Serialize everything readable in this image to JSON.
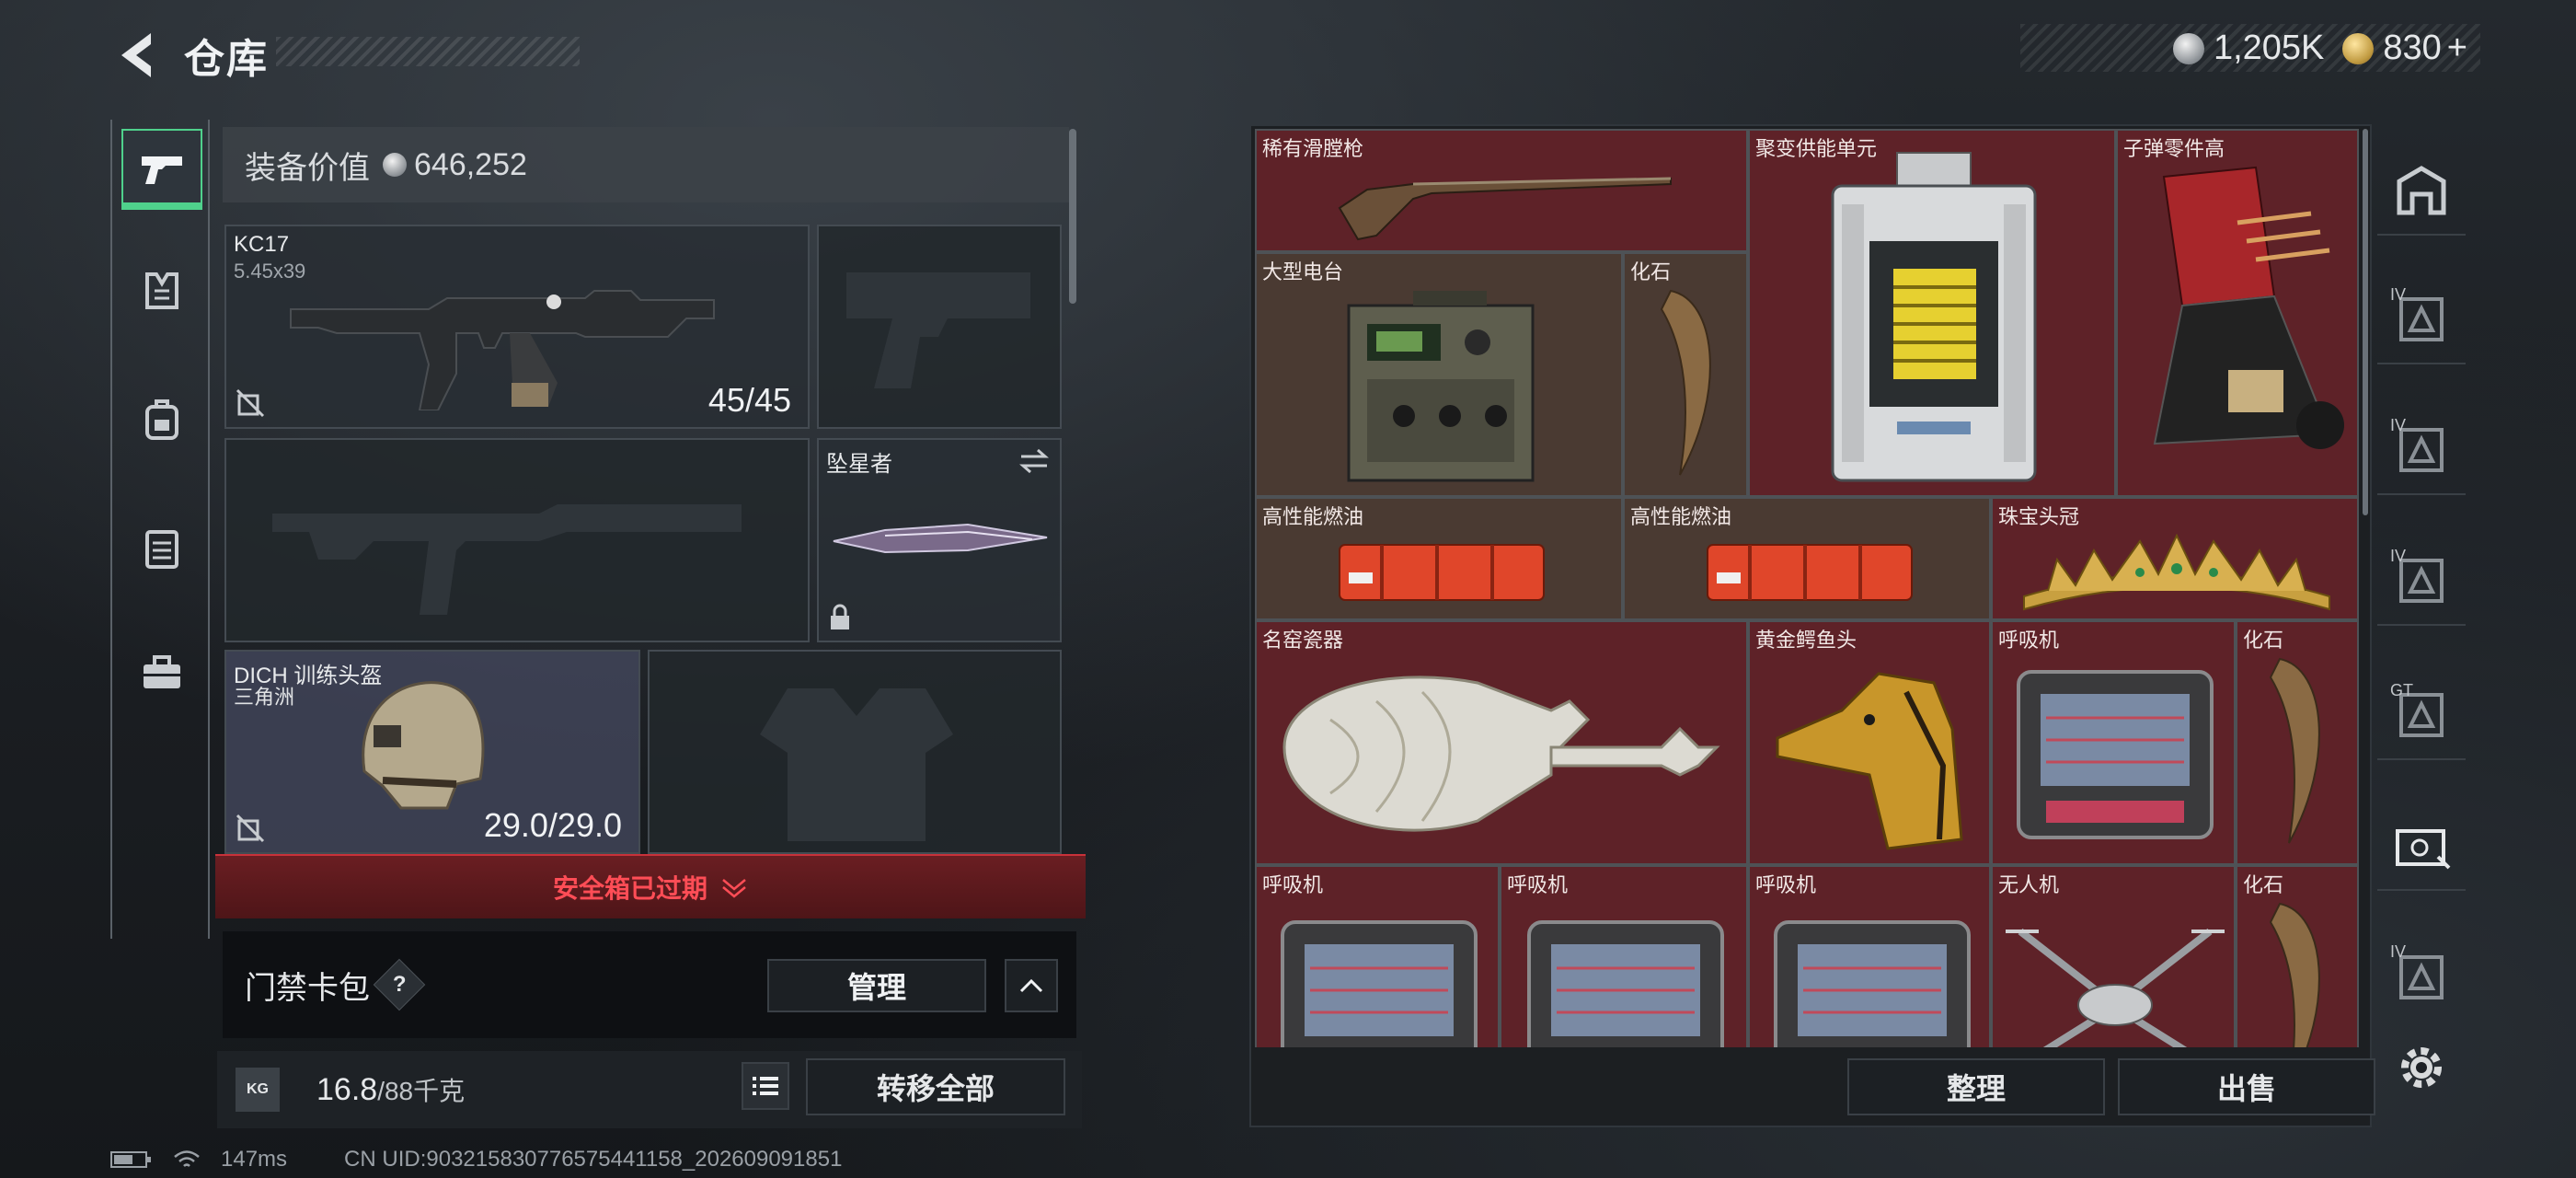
{
  "header": {
    "title": "仓库",
    "currency_silver": "1,205K",
    "currency_gold": "830",
    "gold_plus": "+"
  },
  "left_nav": {
    "items": [
      "pistol-icon",
      "armor-icon",
      "backpack-icon",
      "vest-icon",
      "toolbox-icon"
    ]
  },
  "equipment": {
    "value_label": "装备价值",
    "value": "646,252",
    "primary_weapon": {
      "name": "KC17",
      "caliber": "5.45x39",
      "ammo": "45/45"
    },
    "melee": {
      "name": "坠星者"
    },
    "helmet": {
      "name": "DICH 训练头盔",
      "sub": "三角洲",
      "durability": "29.0/29.0"
    },
    "safe_box_status": "安全箱已过期",
    "keycard_label": "门禁卡包",
    "keycard_help": "?",
    "manage_label": "管理",
    "weight_icon_text": "KG",
    "weight_value": "16.8",
    "weight_max": "/88千克",
    "transfer_all": "转移全部"
  },
  "container": {
    "items": [
      {
        "label": "稀有滑膛枪"
      },
      {
        "label": "聚变供能单元"
      },
      {
        "label": "子弹零件高"
      },
      {
        "label": "大型电台"
      },
      {
        "label": "化石"
      },
      {
        "label": "高性能燃油"
      },
      {
        "label": "高性能燃油"
      },
      {
        "label": "珠宝头冠"
      },
      {
        "label": "名窑瓷器"
      },
      {
        "label": "黄金鳄鱼头"
      },
      {
        "label": "呼吸机"
      },
      {
        "label": "化石"
      },
      {
        "label": "呼吸机"
      },
      {
        "label": "呼吸机"
      },
      {
        "label": "呼吸机"
      },
      {
        "label": "无人机"
      },
      {
        "label": "化石"
      }
    ],
    "sort_label": "整理",
    "sell_label": "出售"
  },
  "right_nav": {
    "tiers": [
      "",
      "IV",
      "IV",
      "IV",
      "GT",
      "",
      "IV"
    ]
  },
  "status_bar": {
    "ping": "147ms",
    "uid": "CN UID:903215830776575441158_202609091851"
  }
}
